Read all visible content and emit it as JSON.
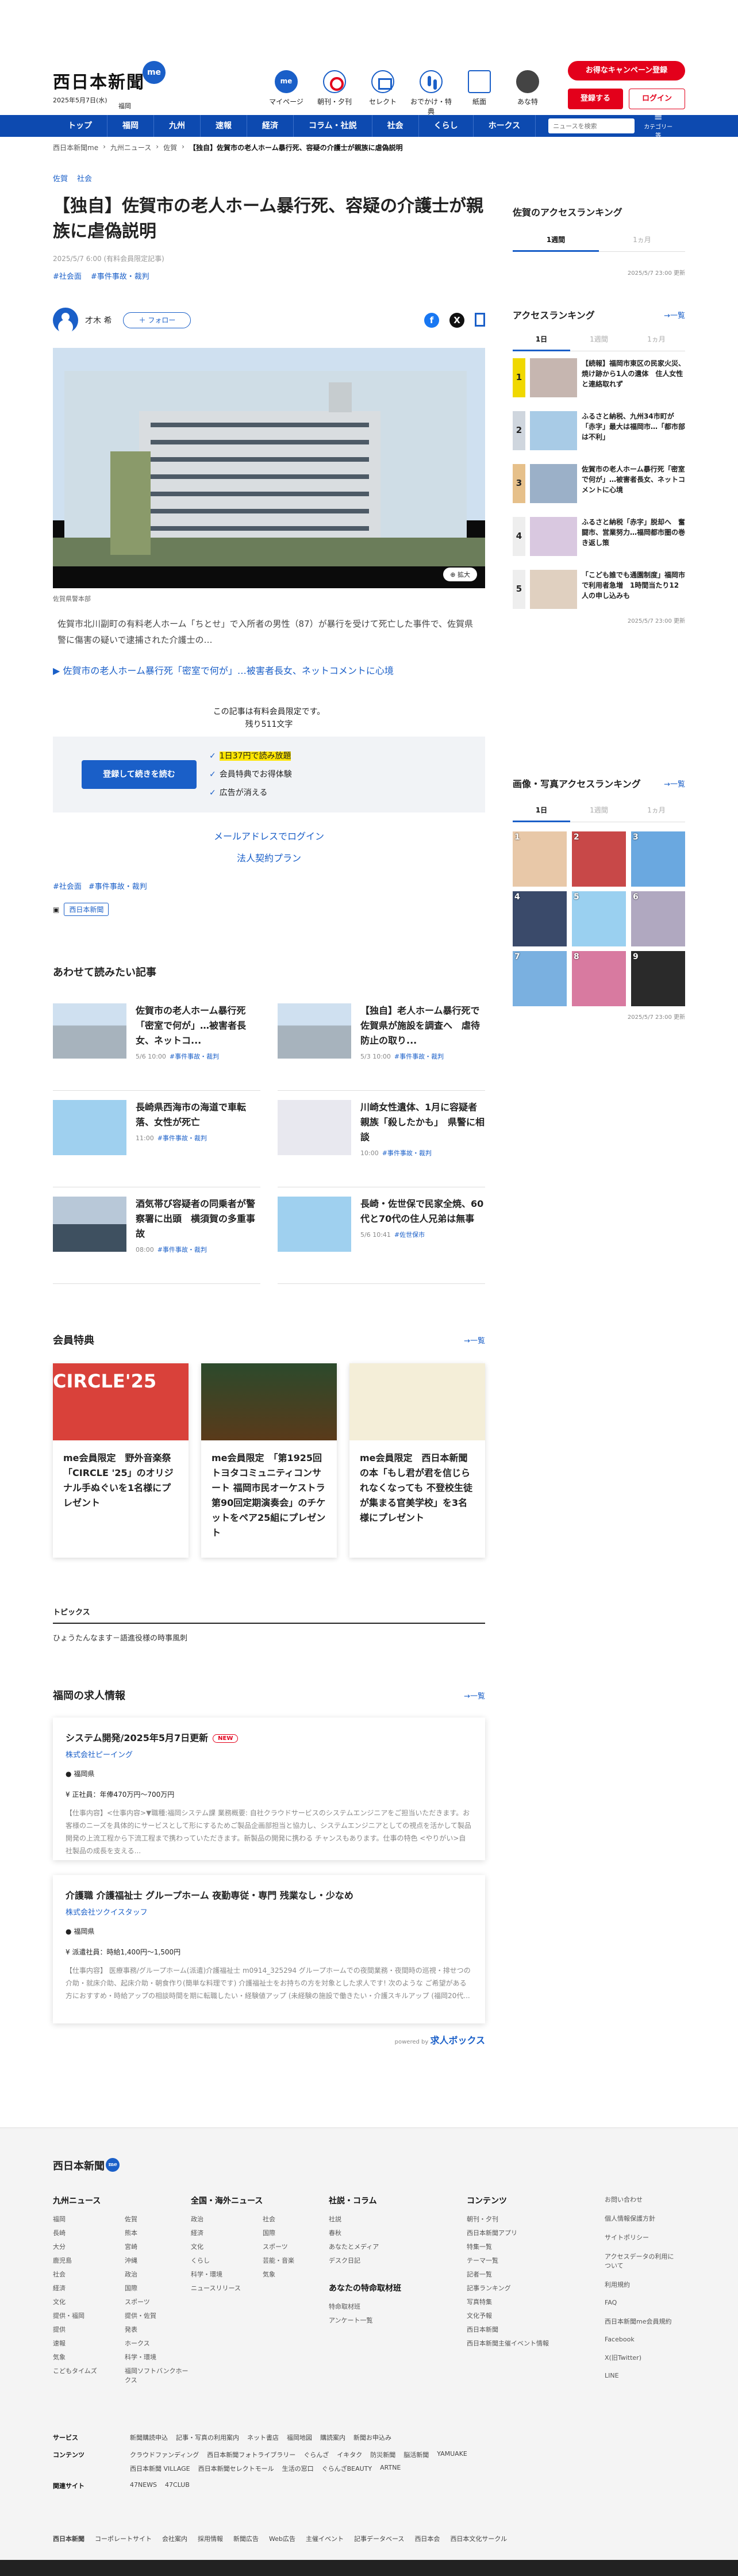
{
  "header": {
    "logo": "西日本新聞",
    "logo_badge": "me",
    "date": "2025年5月7日(水)",
    "area": "福岡",
    "icons": [
      {
        "label": "マイページ",
        "icon": "me-icon"
      },
      {
        "label": "朝刊・夕刊",
        "icon": "newspaper-icon"
      },
      {
        "label": "セレクト",
        "icon": "select-icon"
      },
      {
        "label": "おでかけ・特典",
        "icon": "footprint-icon"
      },
      {
        "label": "紙面",
        "icon": "paper-icon"
      },
      {
        "label": "あな特",
        "icon": "dog-icon"
      }
    ],
    "plan_button": "お得なキャンペーン登録",
    "register_button": "登録する",
    "login_button": "ログイン"
  },
  "nav": {
    "items": [
      "トップ",
      "福岡",
      "九州",
      "速報",
      "経済",
      "コラム・社説",
      "社会",
      "くらし",
      "ホークス"
    ],
    "search_placeholder": "ニュースを検索",
    "menu_label": "カテゴリー等"
  },
  "breadcrumb": [
    "西日本新聞me",
    "九州ニュース",
    "佐賀",
    "【独自】佐賀市の老人ホーム暴行死、容疑の介護士が親族に虐偽説明"
  ],
  "article": {
    "categories": [
      "佐賀",
      "社会"
    ],
    "title": "【独自】佐賀市の老人ホーム暴行死、容疑の介護士が親族に虐偽説明",
    "meta": "2025/5/7 6:00 (有料会員限定記事)",
    "tags": [
      "#社会面",
      "#事件事故・裁判"
    ],
    "author": "才木 希",
    "follow": "＋ フォロー",
    "zoom": "拡大",
    "caption": "佐賀県警本部",
    "lead": "佐賀市北川副町の有料老人ホーム「ちとせ」で入所者の男性（87）が暴行を受けて死亡した事件で、佐賀県警に傷害の疑いで逮捕された介護士の…",
    "related_link": "▶ 佐賀市の老人ホーム暴行死「密室で何が」…被害者長女、ネットコメントに心境",
    "paywall_notice": "この記事は有料会員限定です。",
    "remaining": "残り511文字",
    "paywall_button": "登録して続きを読む",
    "benefits": [
      "1日37円で読み放題",
      "会員特典でお得体験",
      "広告が消える"
    ],
    "mail_login": "メールアドレスでログイン",
    "corporate": "法人契約プラン",
    "tags2": [
      "#社会面",
      "#事件事故・裁判"
    ],
    "source": "西日本新聞"
  },
  "related": {
    "title": "あわせて読みたい記事",
    "items": [
      {
        "title": "佐賀市の老人ホーム暴行死「密室で何が」…被害者長女、ネットコ...",
        "time": "5/6 10:00",
        "tag": "#事件事故・裁判"
      },
      {
        "title": "【独自】老人ホーム暴行死で佐賀県が施設を調査へ　虐待防止の取り...",
        "time": "5/3 10:00",
        "tag": "#事件事故・裁判"
      },
      {
        "title": "長崎県西海市の海道で車転落、女性が死亡",
        "time": "11:00",
        "tag": "#事件事故・裁判"
      },
      {
        "title": "川崎女性遺体、1月に容疑者親族「殺したかも」　県警に相談",
        "time": "10:00",
        "tag": "#事件事故・裁判"
      },
      {
        "title": "酒気帯び容疑者の同乗者が警察署に出頭　横須賀の多重事故",
        "time": "08:00",
        "tag": "#事件事故・裁判"
      },
      {
        "title": "長崎・佐世保で民家全焼、60代と70代の住人兄弟は無事",
        "time": "5/6 10:41",
        "tag": "#佐世保市"
      }
    ]
  },
  "members": {
    "title": "会員特典",
    "more": "一覧",
    "items": [
      {
        "title": "me会員限定　野外音楽祭「CIRCLE '25」のオリジナル手ぬぐいを1名様にプレゼント",
        "art_text": "CIRCLE'25"
      },
      {
        "title": "me会員限定　「第1925回トヨタコミュニティコンサート 福岡市民オーケストラ第90回定期演奏会」のチケットをペア25組にプレゼント",
        "art_text": ""
      },
      {
        "title": "me会員限定　西日本新聞の本「もし君が君を信じられなくなっても 不登校生徒が集まる官美学校」を3名様にプレゼント",
        "art_text": ""
      }
    ]
  },
  "topics": {
    "title": "トピックス",
    "items": [
      "ひょうたんなます－語進役様の時事風刺"
    ]
  },
  "jobs": {
    "title": "福岡の求人情報",
    "more": "一覧",
    "items": [
      {
        "title": "システム開発/2025年5月7日更新",
        "new": "NEW",
        "company": "株式会社ピーイング",
        "location": "福岡県",
        "salary": "正社員：年俸470万円〜700万円",
        "desc": "【仕事内容】<仕事内容>▼職種:福岡システム課 業務概要: 自社クラウドサービスのシステムエンジニアをご担当いただきます。お客様のニーズを具体的にサービスとして形にするためご製品企画部担当と協力し、システムエンジニアとしての視点を活かして製品開発の上流工程から下流工程まで携わっていただきます。新製品の開発に携わる チャンスもあります。仕事の特色 <やりがい>自社製品の成長を支える..."
      },
      {
        "title": "介護職 介護福祉士 グループホーム 夜勤専従・専門 残業なし・少なめ",
        "new": "",
        "company": "株式会社ツクイスタッフ",
        "location": "福岡県",
        "salary": "派遣社員：時給1,400円〜1,500円",
        "desc": "【仕事内容】 医療事務/グループホーム(派遣)介護福祉士 m0914_325294 グループホームでの夜間業務・夜間時の巡視・排せつの介助・就床介助、起床介助・朝食作り(簡単な料理です) 介護福祉士をお持ちの方を対象とした求人です! 次のような ご希望がある方におすすめ・時給アップの相談時間を期に転職したい・経験値アップ (未経験の施設で働きたい・介護スキルアップ (福岡20代..."
      }
    ],
    "powered_by": "powered by",
    "powered_brand": "求人ボックス"
  },
  "sidebar": {
    "access_title": "佐賀のアクセスランキング",
    "access_tabs": [
      "1週間",
      "1ヵ月"
    ],
    "access_time": "2025/5/7 23:00 更新",
    "ranking_title": "アクセスランキング",
    "ranking_more": "一覧",
    "ranking_tabs": [
      "1日",
      "1週間",
      "1ヵ月"
    ],
    "ranking_items": [
      {
        "num": "1",
        "title": "【続報】福岡市東区の民家火災、焼け跡から1人の遺体　住人女性と連絡取れず"
      },
      {
        "num": "2",
        "title": "ふるさと納税、九州34市町が「赤字」最大は福岡市…「都市部は不利」"
      },
      {
        "num": "3",
        "title": "佐賀市の老人ホーム暴行死「密室で何が」…被害者長女、ネットコメントに心境"
      },
      {
        "num": "4",
        "title": "ふるさと納税「赤字」脱却へ　奮闘市、営業努力…福岡都市圏の巻き返し策"
      },
      {
        "num": "5",
        "title": "「こども誰でも通園制度」福岡市で利用者急増　1時間当たり12人の申し込みも"
      }
    ],
    "ranking_time": "2025/5/7 23:00 更新",
    "image_title": "画像・写真アクセスランキング",
    "image_more": "一覧",
    "image_tabs": [
      "1日",
      "1週間",
      "1ヵ月"
    ],
    "image_nums": [
      "1",
      "2",
      "3",
      "4",
      "5",
      "6",
      "7",
      "8",
      "9"
    ],
    "image_time": "2025/5/7 23:00 更新"
  },
  "footer": {
    "logo": "西日本新聞",
    "cols": [
      {
        "title": "九州ニュース",
        "items": [
          "福岡",
          "佐賀",
          "長崎",
          "熊本",
          "大分",
          "宮崎",
          "鹿児島",
          "沖縄",
          "社会",
          "政治",
          "経済",
          "国際",
          "文化",
          "スポーツ",
          "提供・福岡",
          "提供・佐賀",
          "提供",
          "発表",
          "速報",
          "ホークス",
          "気象",
          "科学・環境",
          "こどもタイムズ",
          "福岡ソフトバンクホークス"
        ]
      },
      {
        "title": "全国・海外ニュース",
        "items": [
          "政治",
          "社会",
          "経済",
          "国際",
          "文化",
          "スポーツ",
          "くらし",
          "芸能・音楽",
          "科学・環境",
          "気象",
          "ニュースリリース"
        ]
      },
      {
        "title": "社説・コラム",
        "items": [
          "社説",
          "春秋",
          "あなたとメディア",
          "デスク日記"
        ]
      },
      {
        "title": "コンテンツ",
        "items": [
          "朝刊・夕刊",
          "西日本新聞アプリ",
          "特集一覧",
          "テーマ一覧",
          "記者一覧",
          "記事ランキング",
          "写真特集",
          "文化予報",
          "西日本新聞",
          "西日本新聞主催イベント情報"
        ]
      }
    ],
    "special_title": "あなたの特命取材班",
    "special_items": [
      "特命取材班",
      "アンケート一覧"
    ],
    "last_col": [
      "お問い合わせ",
      "個人情報保護方針",
      "サイトポリシー",
      "アクセスデータの利用について",
      "利用規約",
      "FAQ",
      "西日本新聞me会員規約",
      "Facebook",
      "X(旧Twitter)",
      "LINE"
    ],
    "links": [
      {
        "label": "サービス",
        "items": [
          "新聞購読申込",
          "記事・写真の利用案内",
          "ネット書店",
          "福岡地図",
          "購読案内",
          "新聞お申込み"
        ]
      },
      {
        "label": "コンテンツ",
        "items": [
          "クラウドファンディング",
          "西日本新聞フォトライブラリー",
          "ぐらんざ",
          "イキタク",
          "防災新聞",
          "脳活新聞",
          "YAMUAKE",
          "西日本新聞 VILLAGE",
          "西日本新聞セレクトモール",
          "生活の窓口",
          "ぐらんざBEAUTY",
          "ARTNE"
        ]
      },
      {
        "label": "関連サイト",
        "items": [
          "47NEWS",
          "47CLUB"
        ]
      }
    ],
    "bottom_logo": "西日本新聞",
    "bottom_items": [
      "コーポレートサイト",
      "会社案内",
      "採用情報",
      "新聞広告",
      "Web広告",
      "主催イベント",
      "記事データベース",
      "西日本会",
      "西日本文化サークル"
    ]
  }
}
